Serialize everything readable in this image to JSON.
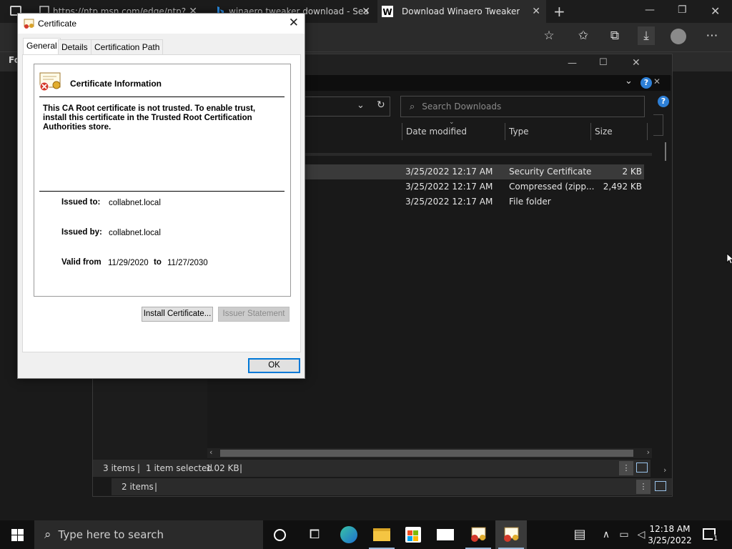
{
  "browser": {
    "tabs": [
      {
        "label": "https://ntp.msn.com/edge/ntp?..."
      },
      {
        "label": "winaero tweaker download - Sea"
      },
      {
        "label": "Download Winaero Tweaker"
      }
    ],
    "favbar_label": "Fo"
  },
  "explorer": {
    "search_placeholder": "Search Downloads",
    "columns": [
      "Date modified",
      "Type",
      "Size"
    ],
    "rows": [
      {
        "date": "3/25/2022 12:17 AM",
        "type": "Security Certificate",
        "size": "2 KB"
      },
      {
        "date": "3/25/2022 12:17 AM",
        "type": "Compressed (zipp...",
        "size": "2,492 KB"
      },
      {
        "date": "3/25/2022 12:17 AM",
        "type": "File folder",
        "size": ""
      }
    ],
    "right_kb1": "KB",
    "right_kb2": "KB",
    "status": {
      "items": "3 items",
      "selected": "1 item selected",
      "size": "1.02 KB"
    },
    "status2": {
      "items": "2 items"
    }
  },
  "certificate": {
    "title": "Certificate",
    "tabs": [
      "General",
      "Details",
      "Certification Path"
    ],
    "info_title": "Certificate Information",
    "warning": "This CA Root certificate is not trusted. To enable trust, install this certificate in the Trusted Root Certification Authorities store.",
    "issued_to_label": "Issued to:",
    "issued_to": "collabnet.local",
    "issued_by_label": "Issued by:",
    "issued_by": "collabnet.local",
    "valid_from_label": "Valid from",
    "valid_from": "11/29/2020",
    "to_label": "to",
    "valid_to": "11/27/2030",
    "install_button": "Install Certificate...",
    "issuer_button": "Issuer Statement",
    "ok_button": "OK"
  },
  "taskbar": {
    "search_placeholder": "Type here to search",
    "time": "12:18 AM",
    "date": "3/25/2022",
    "notification_count": "1"
  },
  "colors": {
    "accent": "#0078d7",
    "taskbar": "#101010",
    "explorer_bg": "#191919"
  }
}
